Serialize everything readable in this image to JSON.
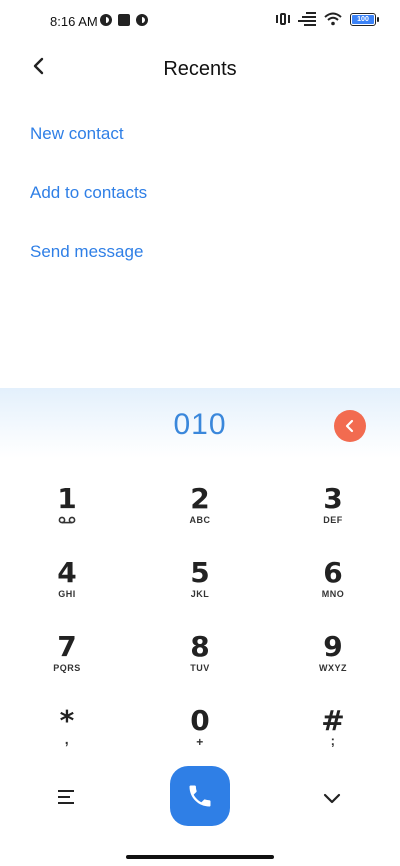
{
  "status_bar": {
    "time": "8:16 AM",
    "battery": "100",
    "icons": [
      "notification-icon",
      "stop-icon",
      "notification-icon",
      "vibrate-icon",
      "signal-icon",
      "wifi-icon",
      "battery-icon"
    ]
  },
  "header": {
    "title": "Recents"
  },
  "actions": {
    "new_contact": "New contact",
    "add_to_contacts": "Add to contacts",
    "send_message": "Send message"
  },
  "dialer": {
    "number": "010",
    "keys": [
      {
        "digit": "1",
        "letters": ""
      },
      {
        "digit": "2",
        "letters": "ABC"
      },
      {
        "digit": "3",
        "letters": "DEF"
      },
      {
        "digit": "4",
        "letters": "GHI"
      },
      {
        "digit": "5",
        "letters": "JKL"
      },
      {
        "digit": "6",
        "letters": "MNO"
      },
      {
        "digit": "7",
        "letters": "PQRS"
      },
      {
        "digit": "8",
        "letters": "TUV"
      },
      {
        "digit": "9",
        "letters": "WXYZ"
      },
      {
        "digit": "*",
        "letters": ","
      },
      {
        "digit": "0",
        "letters": "+"
      },
      {
        "digit": "#",
        "letters": ";"
      }
    ]
  },
  "colors": {
    "accent": "#2f7fe6",
    "number": "#3a87db",
    "delete": "#f26b50"
  }
}
